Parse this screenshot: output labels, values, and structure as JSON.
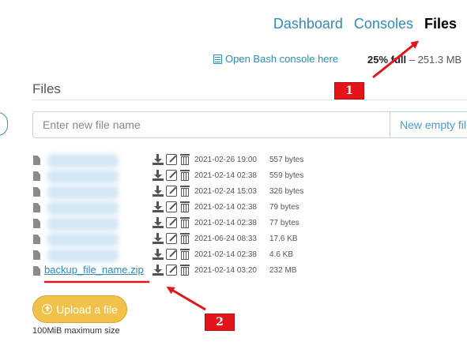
{
  "nav": {
    "dashboard": "Dashboard",
    "consoles": "Consoles",
    "files": "Files"
  },
  "toolbar": {
    "bash_link": "Open Bash console here",
    "quota_used": "25% full",
    "quota_rest": " – 251.3 MB"
  },
  "section": {
    "title": "Files"
  },
  "new_file": {
    "placeholder": "Enter new file name",
    "button": "New empty fil"
  },
  "files": [
    {
      "name": "",
      "date": "2021-02-26 19:00",
      "size": "557 bytes"
    },
    {
      "name": "",
      "date": "2021-02-14 02:38",
      "size": "559 bytes"
    },
    {
      "name": "",
      "date": "2021-02-24 15:03",
      "size": "326 bytes"
    },
    {
      "name": "",
      "date": "2021-02-14 02:38",
      "size": "79 bytes"
    },
    {
      "name": "",
      "date": "2021-02-14 02:38",
      "size": "77 bytes"
    },
    {
      "name": "",
      "date": "2021-06-24 08:33",
      "size": "17.6 KB"
    },
    {
      "name": "",
      "date": "2021-02-14 02:38",
      "size": "4.6 KB"
    },
    {
      "name": "backup_file_name.zip",
      "date": "2021-02-14 03:20",
      "size": "232 MB"
    }
  ],
  "upload": {
    "button": "Upload a file",
    "max_size": "100MiB maximum size"
  },
  "annotations": {
    "callout_1": "1",
    "callout_2": "2",
    "color": "#e3151b"
  },
  "colors": {
    "link": "#2f8bb7",
    "upload": "#f1c24a"
  },
  "icons": {
    "file": "file-icon",
    "download": "download-icon",
    "edit": "edit-icon",
    "delete": "trash-icon",
    "upload": "upload-circle-icon",
    "bash": "console-icon"
  }
}
